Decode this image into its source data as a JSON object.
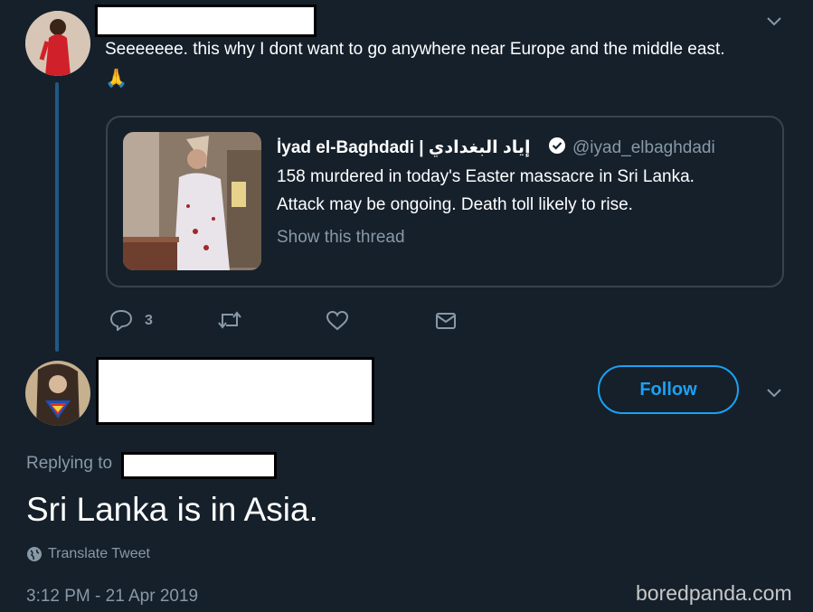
{
  "first_tweet": {
    "text": "Seeeeeee. this why I dont want to go anywhere near Europe and the middle east.",
    "emoji": "🙏"
  },
  "quoted_tweet": {
    "author_name": "İyad el-Baghdadi | إياد البغدادي",
    "handle": "@iyad_elbaghdadi",
    "line1": "158 murdered in today's Easter massacre in Sri Lanka.",
    "line2": "Attack may be ongoing. Death toll likely to rise.",
    "show_thread": "Show this thread"
  },
  "actions": {
    "reply_count": "3"
  },
  "second_tweet": {
    "follow_label": "Follow",
    "replying_to": "Replying to",
    "text": "Sri Lanka is in Asia.",
    "translate": "Translate Tweet",
    "timestamp": "3:12 PM - 21 Apr 2019"
  },
  "watermark": "boredpanda.com",
  "colors": {
    "background": "#15202b",
    "accent": "#1da1f2",
    "muted": "#8899a6",
    "border": "#38444d"
  }
}
